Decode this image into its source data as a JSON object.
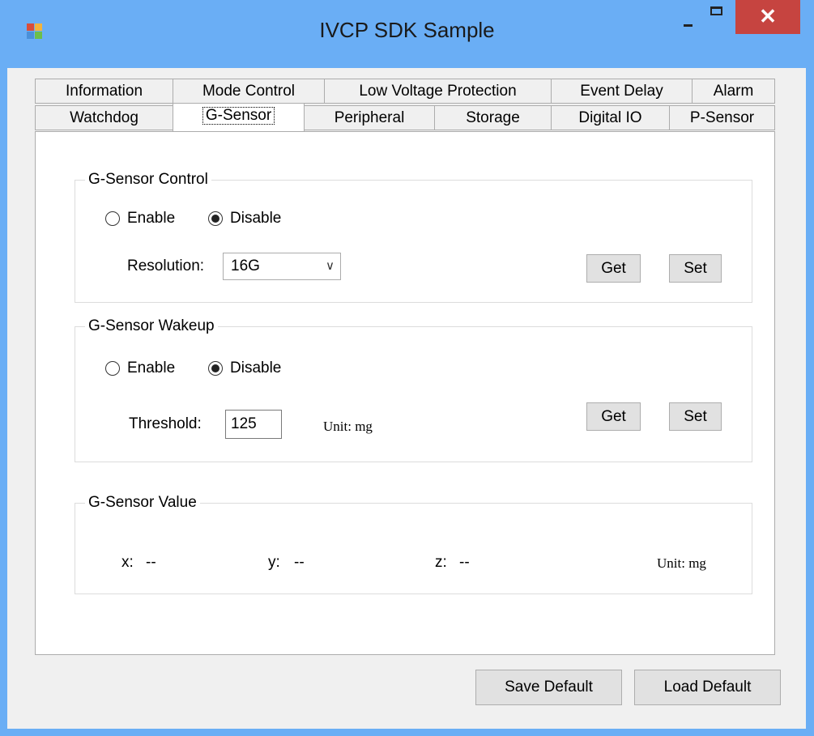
{
  "window": {
    "title": "IVCP SDK Sample",
    "close_glyph": "✕",
    "colors": {
      "frame": "#6aaef5",
      "close": "#c64440",
      "client": "#f0f0f0"
    },
    "icons": [
      "app-icon",
      "minimize-icon",
      "maximize-icon",
      "close-icon"
    ]
  },
  "tabs": {
    "row1": [
      "Information",
      "Mode Control",
      "Low Voltage Protection",
      "Event Delay",
      "Alarm"
    ],
    "row2": [
      "Watchdog",
      "G-Sensor",
      "Peripheral",
      "Storage",
      "Digital IO",
      "P-Sensor"
    ],
    "selected": "G-Sensor"
  },
  "gsensor_control": {
    "legend": "G-Sensor Control",
    "enable_label": "Enable",
    "disable_label": "Disable",
    "selected": "Disable",
    "resolution_label": "Resolution:",
    "resolution_value": "16G",
    "dropdown_glyph": "∨",
    "get_label": "Get",
    "set_label": "Set"
  },
  "gsensor_wakeup": {
    "legend": "G-Sensor Wakeup",
    "enable_label": "Enable",
    "disable_label": "Disable",
    "selected": "Disable",
    "threshold_label": "Threshold:",
    "threshold_value": "125",
    "unit_label": "Unit: mg",
    "get_label": "Get",
    "set_label": "Set"
  },
  "gsensor_value": {
    "legend": "G-Sensor Value",
    "x_label": "x:",
    "x_value": "--",
    "y_label": "y:",
    "y_value": "--",
    "z_label": "z:",
    "z_value": "--",
    "unit_label": "Unit: mg"
  },
  "footer": {
    "save_default_label": "Save Default",
    "load_default_label": "Load Default"
  }
}
